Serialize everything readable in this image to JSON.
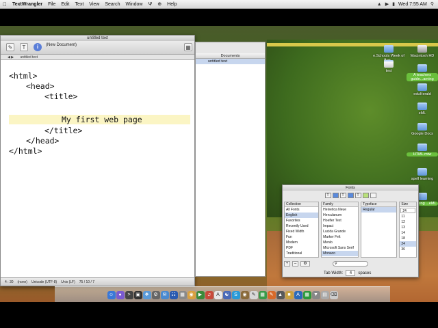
{
  "menubar": {
    "apple": "",
    "app_name": "TextWrangler",
    "items": [
      "File",
      "Edit",
      "Text",
      "View",
      "Search",
      "Window"
    ],
    "extra_glyphs": [
      "Ψ",
      "⊕"
    ],
    "help": "Help",
    "clock": "Wed 7:55 AM"
  },
  "textwrangler": {
    "window_title": "untitled text",
    "doc_label": "(New Document)",
    "path_label": "untitled text",
    "code_lines": [
      "<html>",
      "<head>",
      "<title>",
      "My first web page",
      "</title>",
      "</head>",
      "</html>"
    ],
    "status": {
      "position": "4 : 30",
      "mode": "(none)",
      "encoding": "Unicode (UTF-8)",
      "line_endings": "Unix (LF)",
      "counts": "75 / 10 / 7"
    }
  },
  "documents_drawer": {
    "header": "Documents",
    "items": [
      "untitled text"
    ]
  },
  "fonts_panel": {
    "title": "Fonts",
    "collection_header": "Collection",
    "family_header": "Family",
    "typeface_header": "Typeface",
    "size_header": "Size",
    "collections": [
      "All Fonts",
      "English",
      "Favorites",
      "Recently Used",
      "Fixed Width",
      "Fun",
      "Modern",
      "PDF",
      "Traditional"
    ],
    "selected_collection": "English",
    "families": [
      "Helvetica Neue",
      "Herculanum",
      "Hoefler Text",
      "Impact",
      "Lucida Grande",
      "Marker Felt",
      "Menlo",
      "Microsoft Sans Serif",
      "Monaco"
    ],
    "selected_family": "Monaco",
    "typefaces": [
      "Regular"
    ],
    "size_value": "24",
    "sizes": [
      "11",
      "12",
      "13",
      "14",
      "18",
      "24",
      "36"
    ],
    "selected_size": "24",
    "add_label": "+",
    "remove_label": "–",
    "gear_label": "⚙",
    "tab_width_label": "Tab Width:",
    "tab_width_value": "4",
    "tab_width_unit": "spaces"
  },
  "desktop_icons": [
    {
      "label": "e.Schools Week of Aug..."
    },
    {
      "label": "Macintosh HD"
    },
    {
      "label": "test"
    },
    {
      "label": "A teachers guide...arning"
    },
    {
      "label": "eduHerald"
    },
    {
      "label": "eML"
    },
    {
      "label": "Google Docs"
    },
    {
      "label": "HTML mtw"
    },
    {
      "label": "spell learning"
    },
    {
      "label": "...amming ...eML"
    }
  ],
  "colors": {
    "highlight_line": "#fbf5c4",
    "selection": "#c7d6ee",
    "folder": "#5f95d8"
  }
}
